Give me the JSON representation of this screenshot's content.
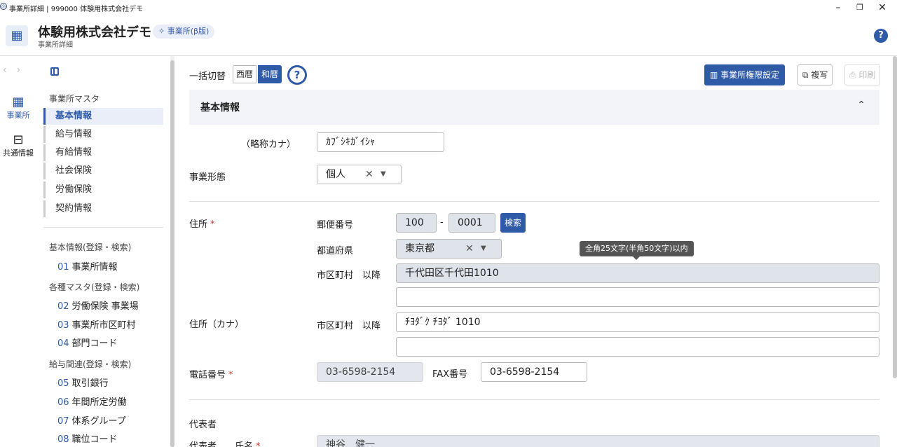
{
  "window": {
    "title": "事業所詳細 | 999000 体験用株式会社デモ",
    "minimize": "–",
    "maximize": "❐",
    "close": "✕"
  },
  "header": {
    "company": "体験用株式会社デモ",
    "badge": "✧ 事業所(β版)",
    "subtitle": "事業所詳細",
    "help": "?"
  },
  "rail": {
    "items": [
      {
        "label": "事業所",
        "icon": "building-icon"
      },
      {
        "label": "共通情報",
        "icon": "panel-icon"
      }
    ]
  },
  "sidemenu": {
    "heading": "事業所マスタ",
    "items": [
      "基本情報",
      "給与情報",
      "有給情報",
      "社会保険",
      "労働保険",
      "契約情報"
    ],
    "active_index": 0,
    "groups": [
      {
        "heading": "基本情報(登録・検索)",
        "links": [
          {
            "num": "01",
            "label": "事業所情報"
          }
        ]
      },
      {
        "heading": "各種マスタ(登録・検索)",
        "links": [
          {
            "num": "02",
            "label": "労働保険 事業場"
          },
          {
            "num": "03",
            "label": "事業所市区町村"
          },
          {
            "num": "04",
            "label": "部門コード"
          }
        ]
      },
      {
        "heading": "給与関連(登録・検索)",
        "links": [
          {
            "num": "05",
            "label": "取引銀行"
          },
          {
            "num": "06",
            "label": "年間所定労働"
          },
          {
            "num": "07",
            "label": "体系グループ"
          },
          {
            "num": "08",
            "label": "職位コード"
          }
        ]
      }
    ]
  },
  "toolbar": {
    "switch_label": "一括切替",
    "seireki": "西暦",
    "wareki": "和暦",
    "help": "?",
    "permission_btn": "事業所権限設定",
    "copy_btn": "複写",
    "print_btn": "印刷"
  },
  "section": {
    "title": "基本情報",
    "chevron": "⌃"
  },
  "form": {
    "abbr_kana_label": "（略称カナ）",
    "abbr_kana_value": "ｶﾌﾞｼｷｶﾞｲｼｬ",
    "business_form_label": "事業形態",
    "business_form_value": "個人",
    "address_label": "住所",
    "required_mark": "*",
    "postal_label": "郵便番号",
    "postal_1": "100",
    "postal_sep": "-",
    "postal_2": "0001",
    "search_btn": "検索",
    "prefecture_label": "都道府県",
    "prefecture_value": "東京都",
    "city_label": "市区町村　以降",
    "city_value": "千代田区千代田1010",
    "city_value_2": "",
    "tooltip": "全角25文字(半角50文字)以内",
    "address_kana_label": "住所（カナ）",
    "city_kana_label": "市区町村　以降",
    "city_kana_value": "ﾁﾖﾀﾞｸ ﾁﾖﾀﾞ 1010",
    "city_kana_value_2": "",
    "phone_label": "電話番号",
    "phone_value": "03-6598-2154",
    "fax_label": "FAX番号",
    "fax_value": "03-6598-2154",
    "rep_section": "代表者",
    "rep_label": "代表者　　氏名",
    "rep_value": "神谷　健一"
  }
}
